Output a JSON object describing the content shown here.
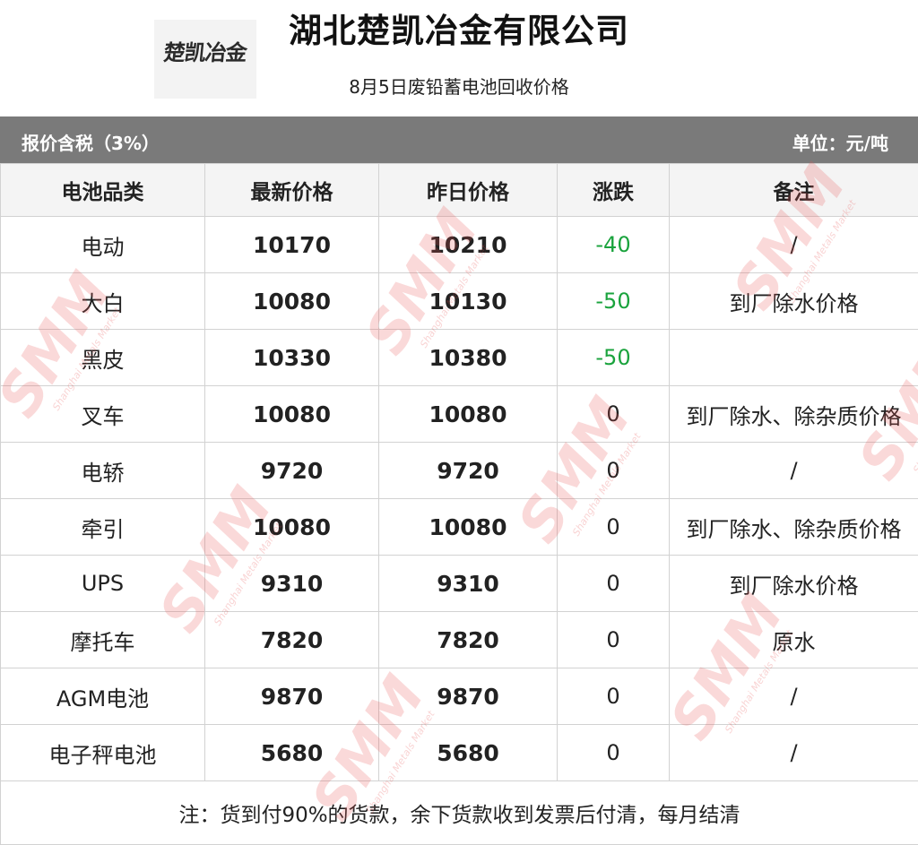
{
  "header": {
    "logo_text": "楚凯冶金",
    "company": "湖北楚凯冶金有限公司",
    "subtitle": "8月5日废铅蓄电池回收价格"
  },
  "bar": {
    "left": "报价含税（3%）",
    "right": "单位：元/吨"
  },
  "table": {
    "headers": [
      "电池品类",
      "最新价格",
      "昨日价格",
      "涨跌",
      "备注"
    ],
    "rows": [
      {
        "type": "电动",
        "latest": "10170",
        "prev": "10210",
        "change": "-40",
        "note": "/"
      },
      {
        "type": "大白",
        "latest": "10080",
        "prev": "10130",
        "change": "-50",
        "note": "到厂除水价格"
      },
      {
        "type": "黑皮",
        "latest": "10330",
        "prev": "10380",
        "change": "-50",
        "note": ""
      },
      {
        "type": "叉车",
        "latest": "10080",
        "prev": "10080",
        "change": "0",
        "note": "到厂除水、除杂质价格"
      },
      {
        "type": "电轿",
        "latest": "9720",
        "prev": "9720",
        "change": "0",
        "note": "/"
      },
      {
        "type": "牵引",
        "latest": "10080",
        "prev": "10080",
        "change": "0",
        "note": "到厂除水、除杂质价格"
      },
      {
        "type": "UPS",
        "latest": "9310",
        "prev": "9310",
        "change": "0",
        "note": "到厂除水价格"
      },
      {
        "type": "摩托车",
        "latest": "7820",
        "prev": "7820",
        "change": "0",
        "note": "原水"
      },
      {
        "type": "AGM电池",
        "latest": "9870",
        "prev": "9870",
        "change": "0",
        "note": "/"
      },
      {
        "type": "电子秤电池",
        "latest": "5680",
        "prev": "5680",
        "change": "0",
        "note": "/"
      }
    ],
    "footer_note": "注：货到付90%的货款，余下货款收到发票后付清，每月结清"
  },
  "watermark": {
    "main": "SMM",
    "sub": "Shanghai Metals Market"
  },
  "colors": {
    "bar_bg": "#7a7a7a",
    "header_bg": "#f4f4f4",
    "decrease": "#1aa33d",
    "watermark": "#e75050"
  }
}
